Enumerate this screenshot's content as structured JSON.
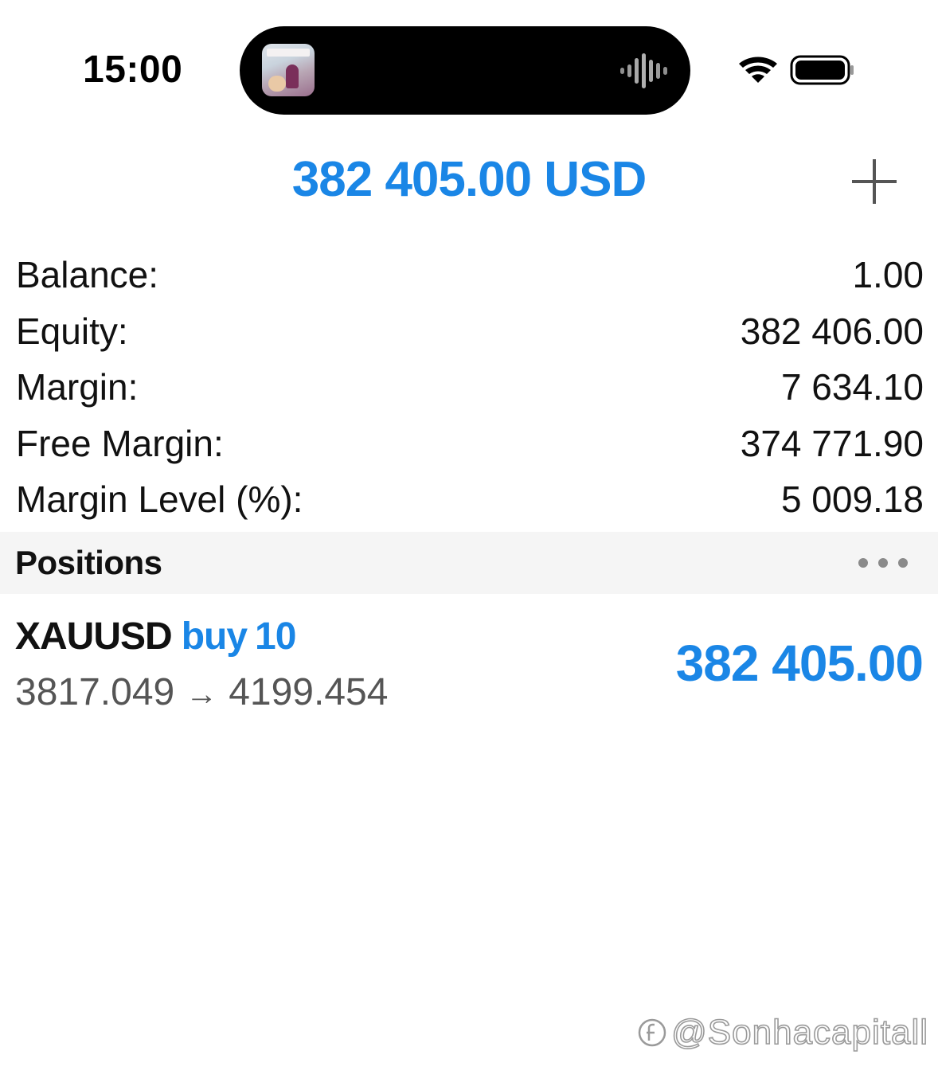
{
  "status_bar": {
    "time": "15:00",
    "icons": [
      "now-playing-artwork",
      "audio-waveform-icon",
      "wifi-icon",
      "battery-icon"
    ]
  },
  "header": {
    "total": "382 405.00 USD",
    "add_icon": "plus-icon"
  },
  "summary": {
    "rows": [
      {
        "label": "Balance:",
        "value": "1.00"
      },
      {
        "label": "Equity:",
        "value": "382 406.00"
      },
      {
        "label": "Margin:",
        "value": "7 634.10"
      },
      {
        "label": "Free Margin:",
        "value": "374 771.90"
      },
      {
        "label": "Margin Level (%):",
        "value": "5 009.18"
      }
    ]
  },
  "positions": {
    "title": "Positions",
    "more_icon": "more-dots-icon",
    "items": [
      {
        "symbol": "XAUUSD",
        "type": "buy",
        "volume": "10",
        "open_price": "3817.049",
        "arrow": "→",
        "current_price": "4199.454",
        "profit": "382 405.00"
      }
    ]
  },
  "watermark": {
    "text": "@Sonhacapitall"
  },
  "colors": {
    "accent": "#1a86e6",
    "section_bg": "#f5f5f5",
    "secondary_text": "#555555"
  }
}
